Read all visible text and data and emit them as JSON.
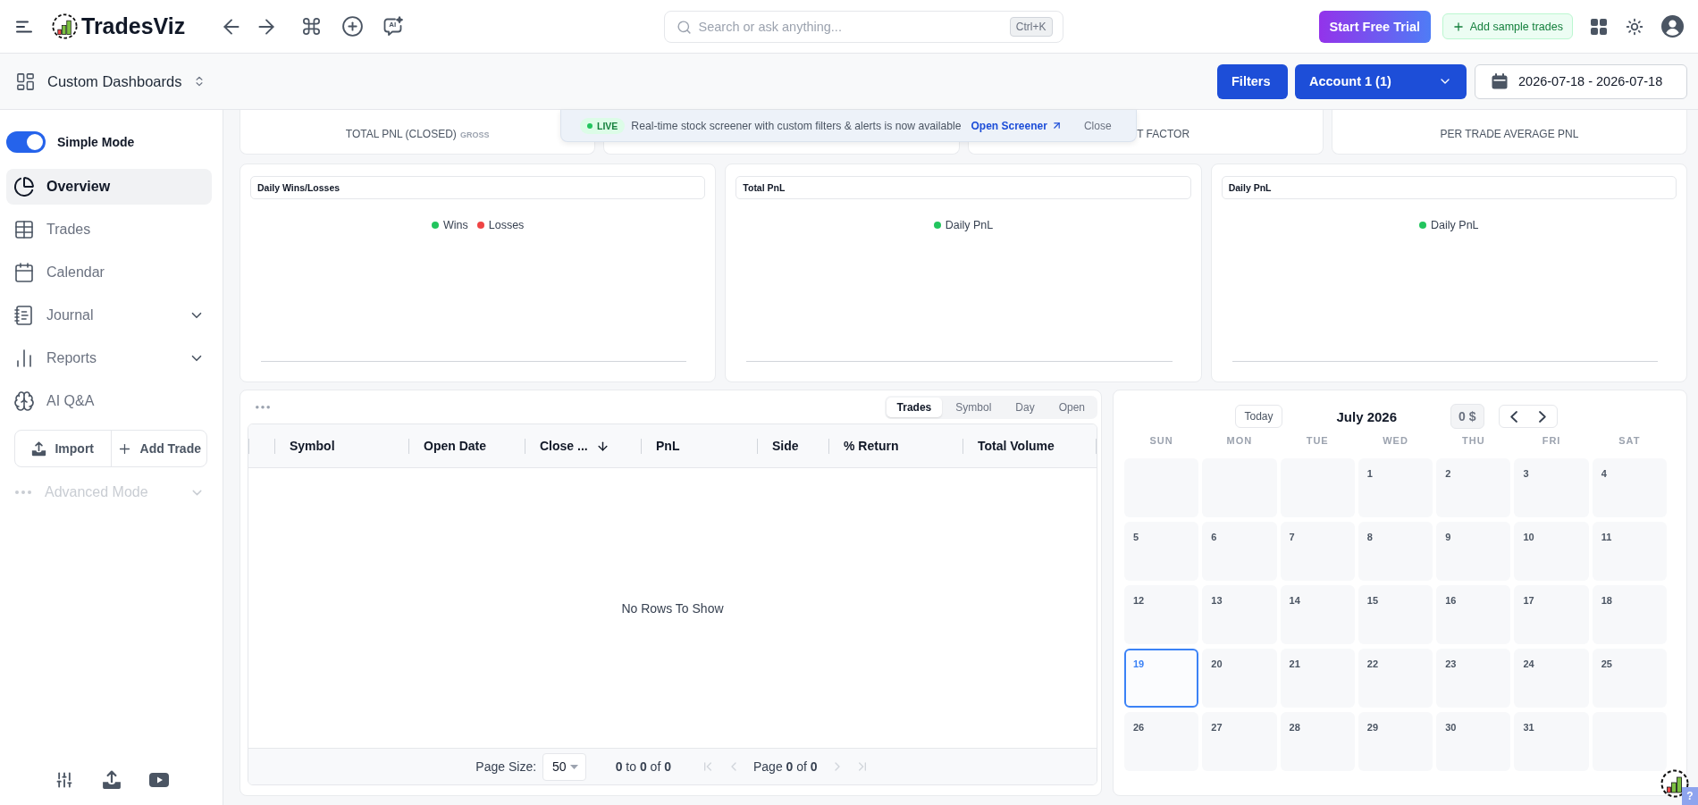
{
  "top_bar": {
    "logo": "TradesViz",
    "ai_button": "AI",
    "search": {
      "placeholder": "Search or ask anything...",
      "shortcut": "Ctrl+K"
    },
    "trial_button": "Start Free Trial",
    "sample_button": "Add sample trades"
  },
  "sub_bar": {
    "dashboard": "Custom Dashboards",
    "filters_button": "Filters",
    "account": "Account 1 (1)",
    "date_range": "2026-07-18 - 2026-07-18"
  },
  "sidebar": {
    "simple_mode": {
      "label": "Simple Mode",
      "on": true
    },
    "items": [
      {
        "kind": "link",
        "label": "Overview",
        "selected": true
      },
      {
        "kind": "link",
        "label": "Trades",
        "selected": false
      },
      {
        "kind": "link",
        "label": "Calendar",
        "selected": false
      },
      {
        "kind": "group",
        "label": "Journal",
        "selected": false,
        "expanded": false
      },
      {
        "kind": "group",
        "label": "Reports",
        "selected": false,
        "expanded": false
      },
      {
        "kind": "link",
        "label": "AI Q&A",
        "selected": false
      }
    ],
    "actions": [
      "Import",
      "Add Trade"
    ],
    "advanced_mode": {
      "label": "Advanced Mode",
      "disabled": true
    }
  },
  "banner": {
    "badge": "LIVE",
    "message": "Real-time stock screener with custom filters & alerts is now available",
    "link": "Open Screener",
    "close": "Close"
  },
  "stat_cards": [
    {
      "kind": "metric",
      "label": "TOTAL PNL (CLOSED)",
      "note": "GROSS"
    },
    {
      "kind": "metric"
    },
    {
      "kind": "metric",
      "label": "T FACTOR"
    },
    {
      "kind": "metric",
      "label": "PER TRADE AVERAGE PNL"
    }
  ],
  "chart_cards": [
    {
      "title": "Daily Wins/Losses",
      "legend": [
        {
          "label": "Wins",
          "color": "#22c55e"
        },
        {
          "label": "Losses",
          "color": "#ef4444"
        }
      ]
    },
    {
      "title": "Total PnL",
      "legend": [
        {
          "label": "Daily PnL",
          "color": "#22c55e"
        }
      ]
    },
    {
      "title": "Daily PnL",
      "legend": [
        {
          "label": "Daily PnL",
          "color": "#22c55e"
        }
      ]
    }
  ],
  "trades_table": {
    "tabs": [
      {
        "label": "Trades",
        "selected": true
      },
      {
        "label": "Symbol",
        "selected": false
      },
      {
        "label": "Day",
        "selected": false
      },
      {
        "label": "Open",
        "selected": false
      }
    ],
    "columns": [
      {
        "label": "Symbol",
        "sorted": false
      },
      {
        "label": "Open Date",
        "sorted": false
      },
      {
        "label": "Close ...",
        "sorted": true
      },
      {
        "label": "PnL",
        "sorted": false
      },
      {
        "label": "Side",
        "sorted": false
      },
      {
        "label": "% Return",
        "sorted": false
      },
      {
        "label": "Total Volume",
        "sorted": false
      }
    ],
    "empty_message": "No Rows To Show",
    "footer": {
      "page_size_label": "Page Size:",
      "page_size": "50",
      "range": "**0** to **0** of **0**",
      "page": "Page **0** of **0**",
      "pager_disabled": true
    }
  },
  "calendar": {
    "today_button": "Today",
    "month": "July 2026",
    "total": "0 $",
    "weekdays": [
      "SUN",
      "MON",
      "TUE",
      "WED",
      "THU",
      "FRI",
      "SAT"
    ],
    "weeks": [
      [
        {
          "kind": "blank"
        },
        {
          "kind": "blank"
        },
        {
          "kind": "blank"
        },
        {
          "kind": "day",
          "day": "1",
          "selected": false
        },
        {
          "kind": "day",
          "day": "2",
          "selected": false
        },
        {
          "kind": "day",
          "day": "3",
          "selected": false
        },
        {
          "kind": "day",
          "day": "4",
          "selected": false
        }
      ],
      [
        {
          "kind": "day",
          "day": "5",
          "selected": false
        },
        {
          "kind": "day",
          "day": "6",
          "selected": false
        },
        {
          "kind": "day",
          "day": "7",
          "selected": false
        },
        {
          "kind": "day",
          "day": "8",
          "selected": false
        },
        {
          "kind": "day",
          "day": "9",
          "selected": false
        },
        {
          "kind": "day",
          "day": "10",
          "selected": false
        },
        {
          "kind": "day",
          "day": "11",
          "selected": false
        }
      ],
      [
        {
          "kind": "day",
          "day": "12",
          "selected": false
        },
        {
          "kind": "day",
          "day": "13",
          "selected": false
        },
        {
          "kind": "day",
          "day": "14",
          "selected": false
        },
        {
          "kind": "day",
          "day": "15",
          "selected": false
        },
        {
          "kind": "day",
          "day": "16",
          "selected": false
        },
        {
          "kind": "day",
          "day": "17",
          "selected": false
        },
        {
          "kind": "day",
          "day": "18",
          "selected": false
        }
      ],
      [
        {
          "kind": "day",
          "day": "19",
          "selected": true
        },
        {
          "kind": "day",
          "day": "20",
          "selected": false
        },
        {
          "kind": "day",
          "day": "21",
          "selected": false
        },
        {
          "kind": "day",
          "day": "22",
          "selected": false
        },
        {
          "kind": "day",
          "day": "23",
          "selected": false
        },
        {
          "kind": "day",
          "day": "24",
          "selected": false
        },
        {
          "kind": "day",
          "day": "25",
          "selected": false
        }
      ],
      [
        {
          "kind": "day",
          "day": "26",
          "selected": false
        },
        {
          "kind": "day",
          "day": "27",
          "selected": false
        },
        {
          "kind": "day",
          "day": "28",
          "selected": false
        },
        {
          "kind": "day",
          "day": "29",
          "selected": false
        },
        {
          "kind": "day",
          "day": "30",
          "selected": false
        },
        {
          "kind": "day",
          "day": "31",
          "selected": false
        },
        {
          "kind": "blank"
        }
      ]
    ]
  },
  "help_widget": {
    "badge": "?"
  }
}
